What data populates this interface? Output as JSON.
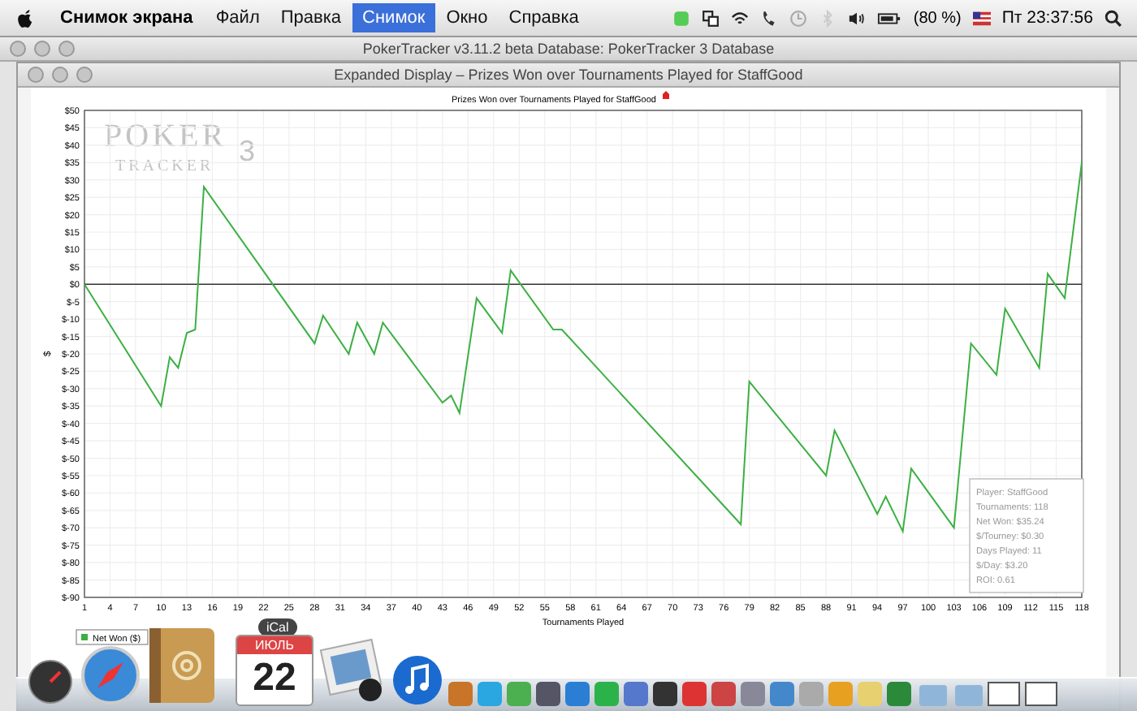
{
  "menu_bar": {
    "app_name": "Снимок экрана",
    "menus": [
      {
        "label": "Файл",
        "selected": false
      },
      {
        "label": "Правка",
        "selected": false
      },
      {
        "label": "Снимок",
        "selected": true
      },
      {
        "label": "Окно",
        "selected": false
      },
      {
        "label": "Справка",
        "selected": false
      }
    ],
    "battery": "(80 %)",
    "clock": "Пт 23:37:56"
  },
  "back_window": {
    "title": "PokerTracker v3.11.2 beta   Database: PokerTracker 3 Database"
  },
  "window": {
    "title": "Expanded Display – Prizes Won over Tournaments Played for StaffGood"
  },
  "chart": {
    "logo": {
      "text": "POKER",
      "subtext": "TRACKER",
      "badge": "3"
    },
    "stats": [
      "Player: StaffGood",
      "Tournaments: 118",
      "Net Won: $35.24",
      "$/Tourney: $0.30",
      "Days Played: 11",
      "$/Day: $3.20",
      "ROI: 0.61"
    ],
    "chart_data": {
      "type": "line",
      "title": "Prizes Won over Tournaments Played for StaffGood",
      "xlabel": "Tournaments Played",
      "ylabel": "$",
      "x": [
        1,
        10,
        11,
        12,
        13,
        14,
        15,
        28,
        29,
        32,
        33,
        35,
        36,
        43,
        44,
        45,
        47,
        50,
        51,
        56,
        57,
        78,
        79,
        88,
        89,
        94,
        95,
        97,
        98,
        103,
        105,
        108,
        109,
        113,
        114,
        116,
        118
      ],
      "series": [
        {
          "name": "Net Won ($)",
          "color": "#3cb043",
          "values": [
            0,
            -35,
            -21,
            -24,
            -14,
            -13,
            28,
            -17,
            -9,
            -20,
            -11,
            -20,
            -11,
            -34,
            -32,
            -37,
            -4,
            -14,
            4,
            -13,
            -13,
            -69,
            -28,
            -55,
            -42,
            -66,
            -61,
            -71,
            -53,
            -70,
            -17,
            -26,
            -7,
            -24,
            3,
            -4,
            35
          ]
        }
      ],
      "grid": true,
      "xlim": [
        1,
        118
      ],
      "ylim": [
        -90,
        50
      ],
      "xticks": [
        1,
        4,
        7,
        10,
        13,
        16,
        19,
        22,
        25,
        28,
        31,
        34,
        37,
        40,
        43,
        46,
        49,
        52,
        55,
        58,
        61,
        64,
        67,
        70,
        73,
        76,
        79,
        82,
        85,
        88,
        91,
        94,
        97,
        100,
        103,
        106,
        109,
        112,
        115,
        118
      ],
      "yticks": [
        {
          "value": 50,
          "label": "$50"
        },
        {
          "value": 45,
          "label": "$45"
        },
        {
          "value": 40,
          "label": "$40"
        },
        {
          "value": 35,
          "label": "$35"
        },
        {
          "value": 30,
          "label": "$30"
        },
        {
          "value": 25,
          "label": "$25"
        },
        {
          "value": 20,
          "label": "$20"
        },
        {
          "value": 15,
          "label": "$15"
        },
        {
          "value": 10,
          "label": "$10"
        },
        {
          "value": 5,
          "label": "$5"
        },
        {
          "value": 0,
          "label": "$0"
        },
        {
          "value": -5,
          "label": "$-5"
        },
        {
          "value": -10,
          "label": "$-10"
        },
        {
          "value": -15,
          "label": "$-15"
        },
        {
          "value": -20,
          "label": "$-20"
        },
        {
          "value": -25,
          "label": "$-25"
        },
        {
          "value": -30,
          "label": "$-30"
        },
        {
          "value": -35,
          "label": "$-35"
        },
        {
          "value": -40,
          "label": "$-40"
        },
        {
          "value": -45,
          "label": "$-45"
        },
        {
          "value": -50,
          "label": "$-50"
        },
        {
          "value": -55,
          "label": "$-55"
        },
        {
          "value": -60,
          "label": "$-60"
        },
        {
          "value": -65,
          "label": "$-65"
        },
        {
          "value": -70,
          "label": "$-70"
        },
        {
          "value": -75,
          "label": "$-75"
        },
        {
          "value": -80,
          "label": "$-80"
        },
        {
          "value": -85,
          "label": "$-85"
        },
        {
          "value": -90,
          "label": "$-90"
        }
      ]
    }
  },
  "dock": {
    "tooltip": "iCal",
    "calendar_month": "ИЮЛЬ",
    "calendar_day": "22"
  }
}
